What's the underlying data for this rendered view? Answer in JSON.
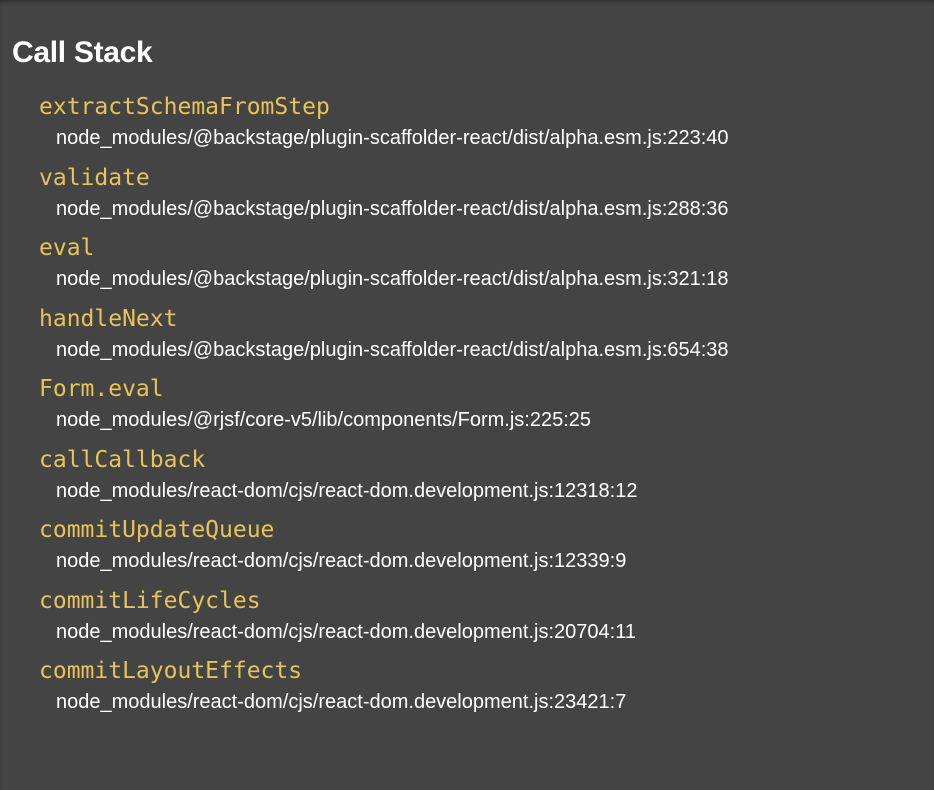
{
  "title": "Call Stack",
  "frames": [
    {
      "fn": "extractSchemaFromStep",
      "loc": "node_modules/@backstage/plugin-scaffolder-react/dist/alpha.esm.js:223:40"
    },
    {
      "fn": "validate",
      "loc": "node_modules/@backstage/plugin-scaffolder-react/dist/alpha.esm.js:288:36"
    },
    {
      "fn": "eval",
      "loc": "node_modules/@backstage/plugin-scaffolder-react/dist/alpha.esm.js:321:18"
    },
    {
      "fn": "handleNext",
      "loc": "node_modules/@backstage/plugin-scaffolder-react/dist/alpha.esm.js:654:38"
    },
    {
      "fn": "Form.eval",
      "loc": "node_modules/@rjsf/core-v5/lib/components/Form.js:225:25"
    },
    {
      "fn": "callCallback",
      "loc": "node_modules/react-dom/cjs/react-dom.development.js:12318:12"
    },
    {
      "fn": "commitUpdateQueue",
      "loc": "node_modules/react-dom/cjs/react-dom.development.js:12339:9"
    },
    {
      "fn": "commitLifeCycles",
      "loc": "node_modules/react-dom/cjs/react-dom.development.js:20704:11"
    },
    {
      "fn": "commitLayoutEffects",
      "loc": "node_modules/react-dom/cjs/react-dom.development.js:23421:7"
    }
  ]
}
